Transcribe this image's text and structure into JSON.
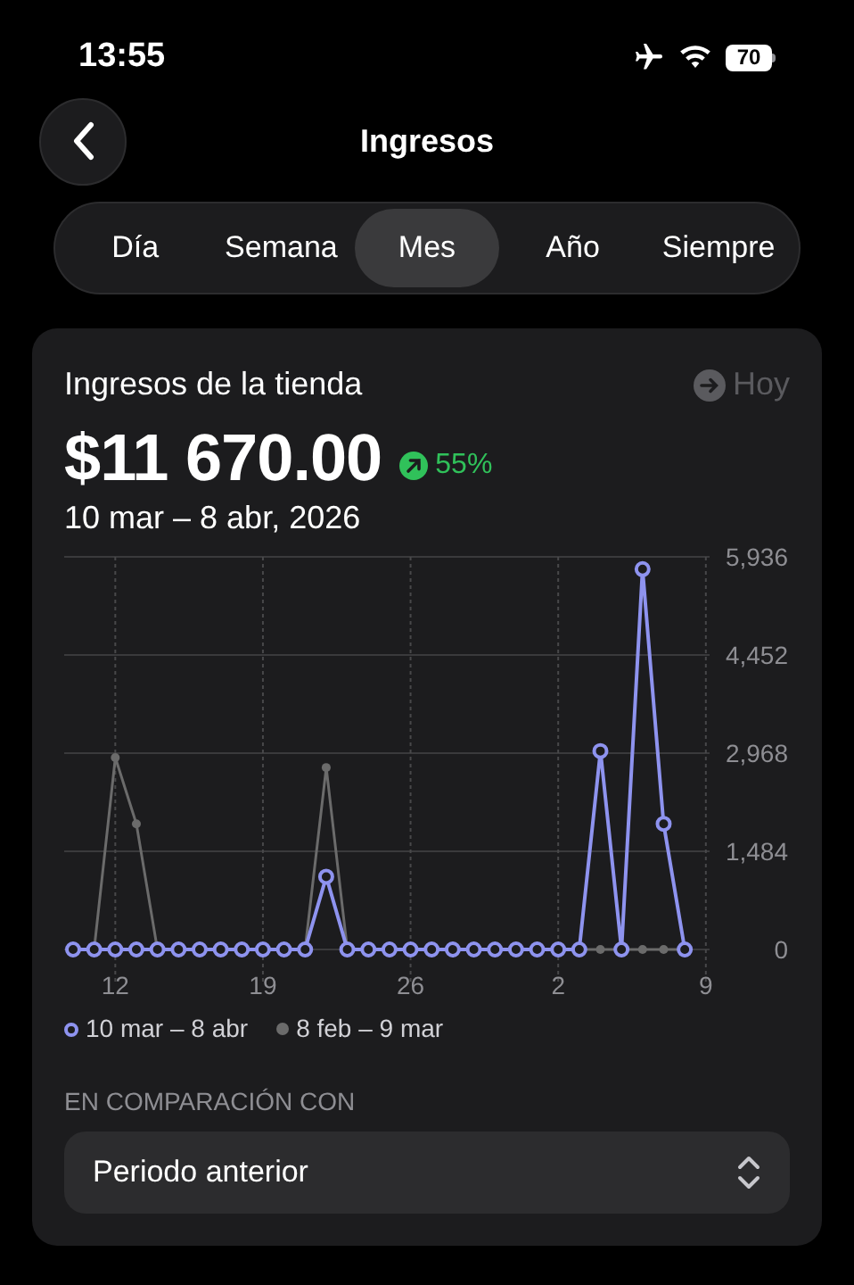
{
  "status_bar": {
    "time": "13:55",
    "battery": "70"
  },
  "header": {
    "title": "Ingresos"
  },
  "tabs": [
    {
      "label": "Día",
      "selected": false
    },
    {
      "label": "Semana",
      "selected": false
    },
    {
      "label": "Mes",
      "selected": true
    },
    {
      "label": "Año",
      "selected": false
    },
    {
      "label": "Siempre",
      "selected": false
    }
  ],
  "card": {
    "title": "Ingresos de la tienda",
    "today_link": {
      "label": "Hoy",
      "disabled": true
    },
    "total": "$11 670.00",
    "change": "55%",
    "range": "10 mar – 8 abr, 2026",
    "chart_data": {
      "type": "line",
      "categories": [
        null,
        null,
        "12",
        null,
        null,
        null,
        null,
        null,
        null,
        "19",
        null,
        null,
        null,
        null,
        null,
        null,
        "26",
        null,
        null,
        null,
        null,
        null,
        null,
        "2",
        null,
        null,
        null,
        null,
        null,
        null,
        "9"
      ],
      "grid": true,
      "series": [
        {
          "name": "10 mar – 8 abr",
          "color": "#8e93ef",
          "marker": "circle",
          "values": [
            0,
            0,
            0,
            0,
            0,
            0,
            0,
            0,
            0,
            0,
            0,
            0,
            1100,
            0,
            0,
            0,
            0,
            0,
            0,
            0,
            0,
            0,
            0,
            0,
            0,
            3000,
            0,
            5750,
            1900,
            0,
            null
          ]
        },
        {
          "name": "8 feb – 9 mar",
          "color": "#6b6b6b",
          "marker": "circle",
          "values": [
            0,
            0,
            2900,
            1900,
            0,
            0,
            0,
            0,
            0,
            0,
            0,
            0,
            2750,
            0,
            0,
            0,
            0,
            0,
            0,
            0,
            0,
            0,
            0,
            0,
            0,
            0,
            0,
            0,
            0,
            0,
            null
          ]
        }
      ],
      "ylim": [
        0,
        5936
      ],
      "yticks": [
        {
          "value": 0,
          "label": "0"
        },
        {
          "value": 1484,
          "label": "1,484"
        },
        {
          "value": 2968,
          "label": "2,968"
        },
        {
          "value": 4452,
          "label": "4,452"
        },
        {
          "value": 5936,
          "label": "5,936"
        }
      ]
    },
    "comparison_label": "EN COMPARACIÓN CON",
    "comparison_value": "Periodo anterior"
  }
}
